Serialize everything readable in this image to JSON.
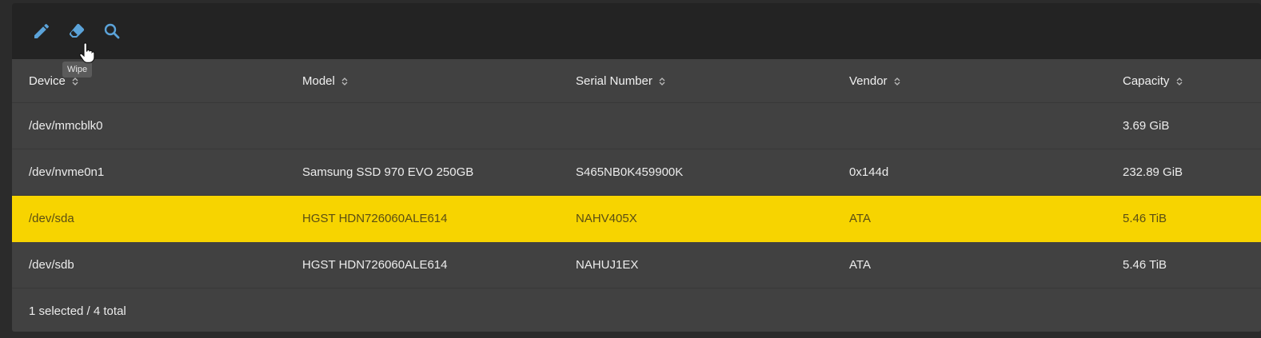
{
  "toolbar": {
    "buttons": [
      {
        "icon": "pencil-icon",
        "label": "Edit"
      },
      {
        "icon": "eraser-icon",
        "label": "Wipe"
      },
      {
        "icon": "search-icon",
        "label": "Search"
      }
    ],
    "tooltip": "Wipe"
  },
  "columns": [
    "Device",
    "Model",
    "Serial Number",
    "Vendor",
    "Capacity"
  ],
  "rows": [
    {
      "device": "/dev/mmcblk0",
      "model": "",
      "serial": "",
      "vendor": "",
      "capacity": "3.69 GiB",
      "selected": false
    },
    {
      "device": "/dev/nvme0n1",
      "model": "Samsung SSD 970 EVO 250GB",
      "serial": "S465NB0K459900K",
      "vendor": "0x144d",
      "capacity": "232.89 GiB",
      "selected": false
    },
    {
      "device": "/dev/sda",
      "model": "HGST HDN726060ALE614",
      "serial": "NAHV405X",
      "vendor": "ATA",
      "capacity": "5.46 TiB",
      "selected": true
    },
    {
      "device": "/dev/sdb",
      "model": "HGST HDN726060ALE614",
      "serial": "NAHUJ1EX",
      "vendor": "ATA",
      "capacity": "5.46 TiB",
      "selected": false
    }
  ],
  "footer": {
    "status": "1 selected / 4 total"
  },
  "colors": {
    "accent_icon": "#5ba3d9",
    "selected_row": "#f7d400"
  }
}
